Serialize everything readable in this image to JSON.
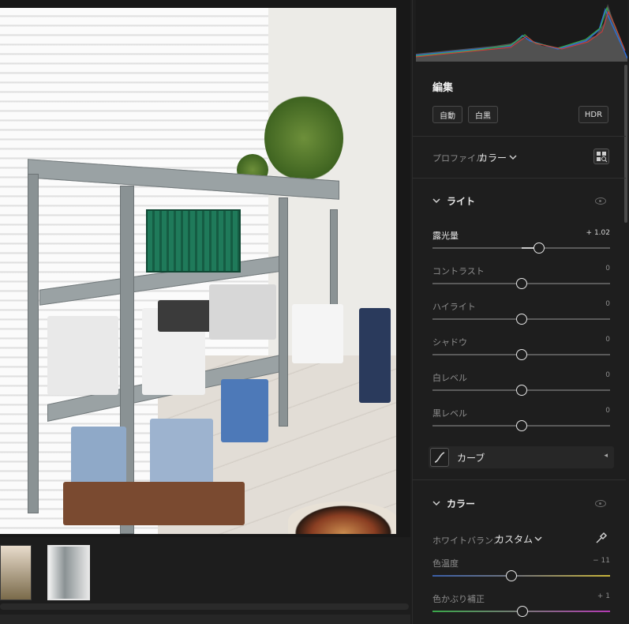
{
  "panel": {
    "edit_title": "編集",
    "auto_label": "自動",
    "bw_label": "白黒",
    "hdr_label": "HDR",
    "profile_label": "プロファイル",
    "profile_value": "カラー",
    "light": {
      "title": "ライト",
      "sliders": [
        {
          "name": "露光量",
          "value": "+ 1.02",
          "level": 1.02,
          "range": [
            -5,
            5
          ],
          "active": true
        },
        {
          "name": "コントラスト",
          "value": "0",
          "level": 0,
          "range": [
            -100,
            100
          ]
        },
        {
          "name": "ハイライト",
          "value": "0",
          "level": 0,
          "range": [
            -100,
            100
          ]
        },
        {
          "name": "シャドウ",
          "value": "0",
          "level": 0,
          "range": [
            -100,
            100
          ]
        },
        {
          "name": "白レベル",
          "value": "0",
          "level": 0,
          "range": [
            -100,
            100
          ]
        },
        {
          "name": "黒レベル",
          "value": "0",
          "level": 0,
          "range": [
            -100,
            100
          ]
        }
      ],
      "curve_label": "カーブ"
    },
    "color": {
      "title": "カラー",
      "wb_label": "ホワイトバランス",
      "wb_value": "カスタム",
      "sliders": [
        {
          "name": "色温度",
          "value": "− 11",
          "level": -11,
          "range": [
            -100,
            100
          ],
          "gradient": "temp"
        },
        {
          "name": "色かぶり補正",
          "value": "+ 1",
          "level": 1,
          "range": [
            -100,
            100
          ],
          "gradient": "tint"
        }
      ]
    },
    "colors": {
      "temp_left": "#3a5fa8",
      "temp_right": "#c8b43a",
      "tint_left": "#3aa84a",
      "tint_right": "#b43ab4"
    }
  },
  "icons": [
    "chevron-down-icon",
    "profile-browser-icon",
    "eye-icon",
    "curve-icon",
    "eyedropper-icon",
    "caret-left-icon"
  ]
}
